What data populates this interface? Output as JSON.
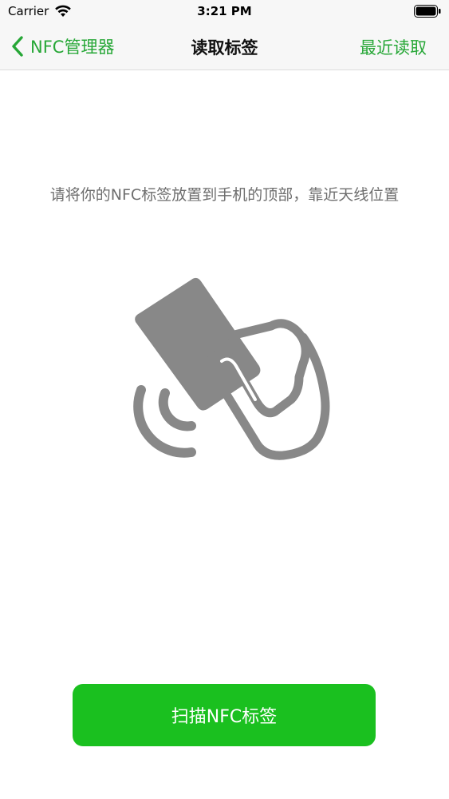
{
  "status_bar": {
    "carrier": "Carrier",
    "time": "3:21 PM"
  },
  "nav": {
    "back_label": "NFC管理器",
    "title": "读取标签",
    "right_label": "最近读取"
  },
  "content": {
    "instruction": "请将你的NFC标签放置到手机的顶部，靠近天线位置",
    "illustration_icon": "nfc-hand-card-icon"
  },
  "actions": {
    "scan_label": "扫描NFC标签"
  },
  "colors": {
    "accent": "#27a737",
    "button": "#1ac01f",
    "icon_gray": "#888888"
  }
}
